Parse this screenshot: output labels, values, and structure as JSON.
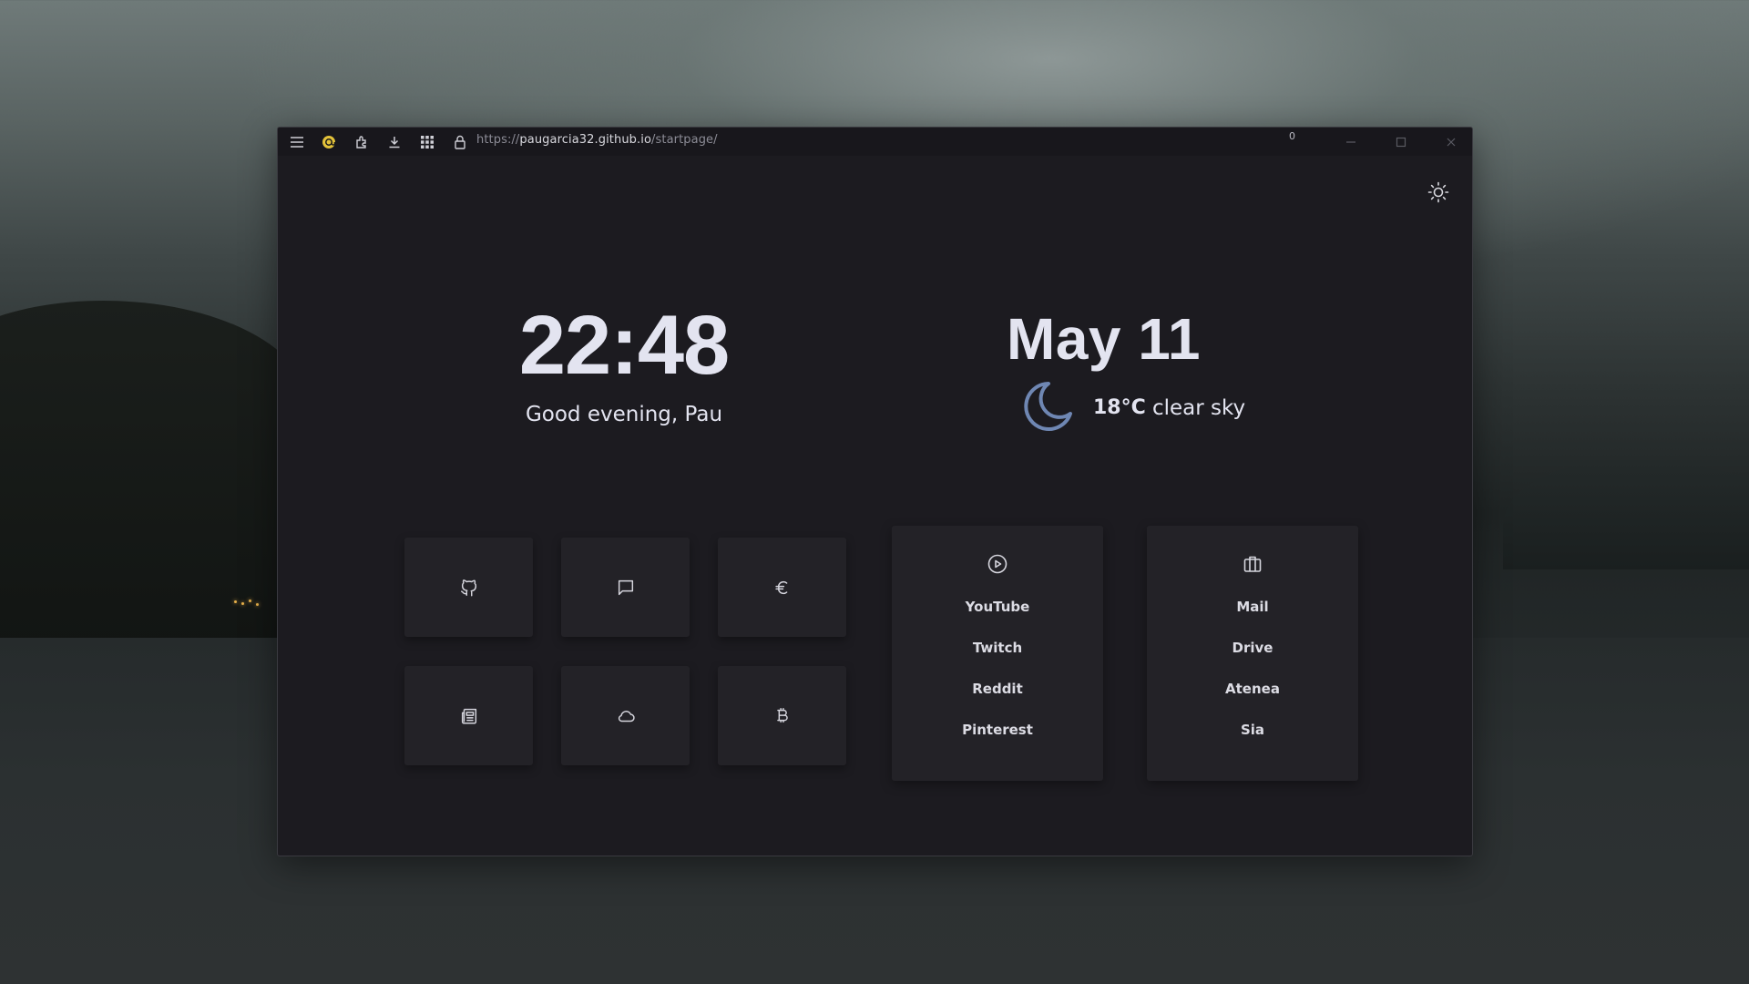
{
  "browser": {
    "url_scheme": "https://",
    "url_host": "paugarcia32.github.io",
    "url_path": "/startpage/",
    "notification_count": "0"
  },
  "page": {
    "time": "22:48",
    "greeting": "Good evening, Pau",
    "date": "May 11",
    "temperature": "18°C",
    "weather_description": "clear sky",
    "weather_icon": "moon-icon",
    "theme_toggle_icon": "sun-icon"
  },
  "tiles": [
    {
      "icon": "github-icon"
    },
    {
      "icon": "chat-icon"
    },
    {
      "icon": "euro-icon"
    },
    {
      "icon": "newspaper-icon"
    },
    {
      "icon": "cloud-icon"
    },
    {
      "icon": "bitcoin-icon"
    }
  ],
  "cards": [
    {
      "icon": "play-circle-icon",
      "links": [
        "YouTube",
        "Twitch",
        "Reddit",
        "Pinterest"
      ]
    },
    {
      "icon": "briefcase-icon",
      "links": [
        "Mail",
        "Drive",
        "Atenea",
        "Sia"
      ]
    }
  ],
  "colors": {
    "page_background": "#1c1b20",
    "tile_background": "#232227",
    "text": "#e3e4f0",
    "moon_accent": "#6f87b3"
  }
}
